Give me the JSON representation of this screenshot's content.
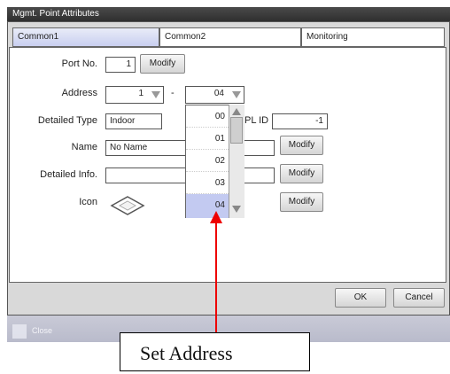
{
  "window": {
    "title": "Mgmt. Point Attributes",
    "tabs": [
      {
        "label": "Common1",
        "active": true
      },
      {
        "label": "Common2",
        "active": false
      },
      {
        "label": "Monitoring",
        "active": false
      }
    ]
  },
  "form": {
    "port_no": {
      "label": "Port No.",
      "value": "1",
      "button": "Modify"
    },
    "address": {
      "label": "Address",
      "value_left": "1",
      "separator": "-",
      "value_right": "04"
    },
    "detailed_type": {
      "label": "Detailed Type",
      "value": "Indoor"
    },
    "pl_id": {
      "label": "PL ID",
      "value": "-1"
    },
    "name": {
      "label": "Name",
      "value": "No Name",
      "button": "Modify"
    },
    "detailed_info": {
      "label": "Detailed Info.",
      "value": "",
      "button": "Modify"
    },
    "icon": {
      "label": "Icon",
      "icon": "diamond-icon",
      "button": "Modify"
    }
  },
  "address_dropdown": {
    "options": [
      "00",
      "01",
      "02",
      "03",
      "04"
    ],
    "selected": "04"
  },
  "footer": {
    "ok": "OK",
    "cancel": "Cancel",
    "close": "Close"
  },
  "annotation": {
    "text": "Set Address",
    "arrow_color": "#ee0000"
  },
  "colors": {
    "accent_tab": "#c9cff0",
    "selected_option": "#c3caf1",
    "arrow": "#ee0000"
  }
}
